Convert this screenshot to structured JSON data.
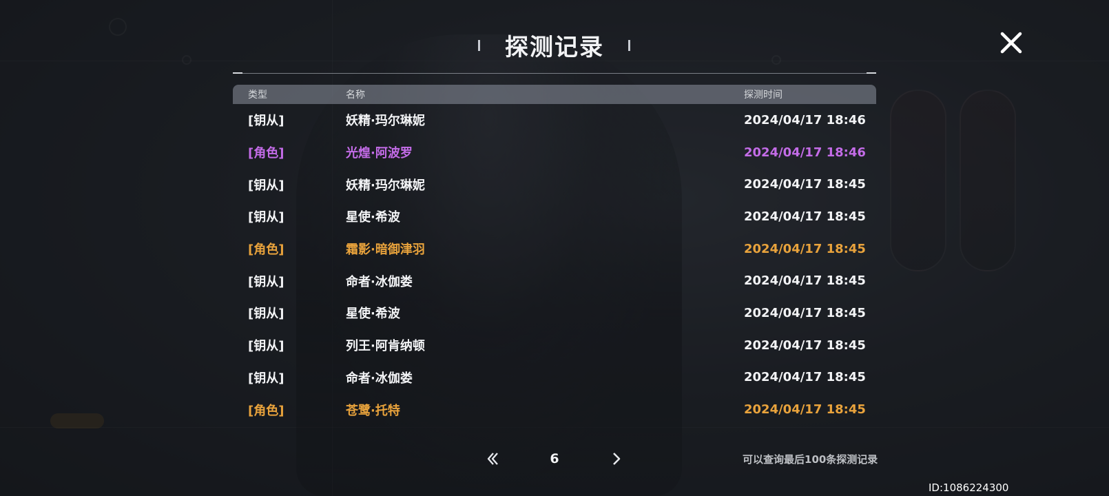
{
  "modal": {
    "title": "探测记录",
    "close_icon": "close-icon"
  },
  "table": {
    "headers": {
      "type": "类型",
      "name": "名称",
      "time": "探测时间"
    },
    "rows": [
      {
        "type": "[钥从]",
        "name": "妖精·玛尔琳妮",
        "time": "2024/04/17 18:46",
        "tone": "normal"
      },
      {
        "type": "[角色]",
        "name": "光煌·阿波罗",
        "time": "2024/04/17 18:46",
        "tone": "purple"
      },
      {
        "type": "[钥从]",
        "name": "妖精·玛尔琳妮",
        "time": "2024/04/17 18:45",
        "tone": "normal"
      },
      {
        "type": "[钥从]",
        "name": "星使·希波",
        "time": "2024/04/17 18:45",
        "tone": "normal"
      },
      {
        "type": "[角色]",
        "name": "霜影·暗御津羽",
        "time": "2024/04/17 18:45",
        "tone": "orange"
      },
      {
        "type": "[钥从]",
        "name": "命者·冰伽娄",
        "time": "2024/04/17 18:45",
        "tone": "normal"
      },
      {
        "type": "[钥从]",
        "name": "星使·希波",
        "time": "2024/04/17 18:45",
        "tone": "normal"
      },
      {
        "type": "[钥从]",
        "name": "列王·阿肯纳顿",
        "time": "2024/04/17 18:45",
        "tone": "normal"
      },
      {
        "type": "[钥从]",
        "name": "命者·冰伽娄",
        "time": "2024/04/17 18:45",
        "tone": "normal"
      },
      {
        "type": "[角色]",
        "name": "苍鹭·托特",
        "time": "2024/04/17 18:45",
        "tone": "orange"
      }
    ]
  },
  "pager": {
    "current_page": "6",
    "prev_icon": "chevron-left-icon",
    "next_icon": "chevron-right-icon"
  },
  "hint": "可以查询最后100条探测记录",
  "user_id": "ID:1086224300",
  "colors": {
    "normal": "#f3f4f6",
    "purple": "#c46ce8",
    "orange": "#e9a33c"
  }
}
